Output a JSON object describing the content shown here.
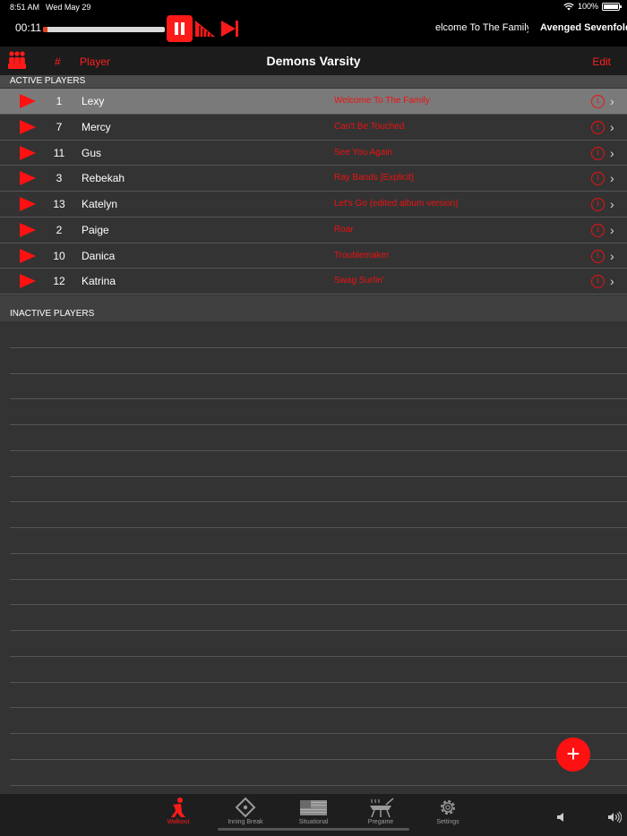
{
  "status_bar": {
    "time": "8:51 AM",
    "date": "Wed May 29",
    "battery": "100%"
  },
  "now_playing": {
    "elapsed": "00:11",
    "progress": 0.04,
    "song": "elcome To The Family",
    "artist": "Avenged Sevenfold"
  },
  "header": {
    "num_label": "#",
    "player_label": "Player",
    "title": "Demons Varsity",
    "edit_label": "Edit"
  },
  "sections": {
    "active": "ACTIVE PLAYERS",
    "inactive": "INACTIVE PLAYERS"
  },
  "active_players": [
    {
      "number": "1",
      "name": "Lexy",
      "song": "Welcome To The Family"
    },
    {
      "number": "7",
      "name": "Mercy",
      "song": "Can't Be Touched"
    },
    {
      "number": "11",
      "name": "Gus",
      "song": "See You Again"
    },
    {
      "number": "3",
      "name": "Rebekah",
      "song": "Ray Bands [Explicit]"
    },
    {
      "number": "13",
      "name": "Katelyn",
      "song": "Let's Go (edited album version)"
    },
    {
      "number": "2",
      "name": "Paige",
      "song": "Roar"
    },
    {
      "number": "10",
      "name": "Danica",
      "song": "Troublemaker"
    },
    {
      "number": "12",
      "name": "Katrina",
      "song": "Swag Surfin'"
    }
  ],
  "tabs": [
    {
      "label": "Walkout",
      "icon": "walkout-icon",
      "active": true
    },
    {
      "label": "Inning Break",
      "icon": "diamond-icon",
      "active": false
    },
    {
      "label": "Situational",
      "icon": "flag-icon",
      "active": false
    },
    {
      "label": "Pregame",
      "icon": "grill-icon",
      "active": false
    },
    {
      "label": "Settings",
      "icon": "gear-icon",
      "active": false
    }
  ],
  "fab_label": "+",
  "colors": {
    "accent": "#ff1a1a",
    "background": "#333333",
    "bar": "#000000"
  }
}
